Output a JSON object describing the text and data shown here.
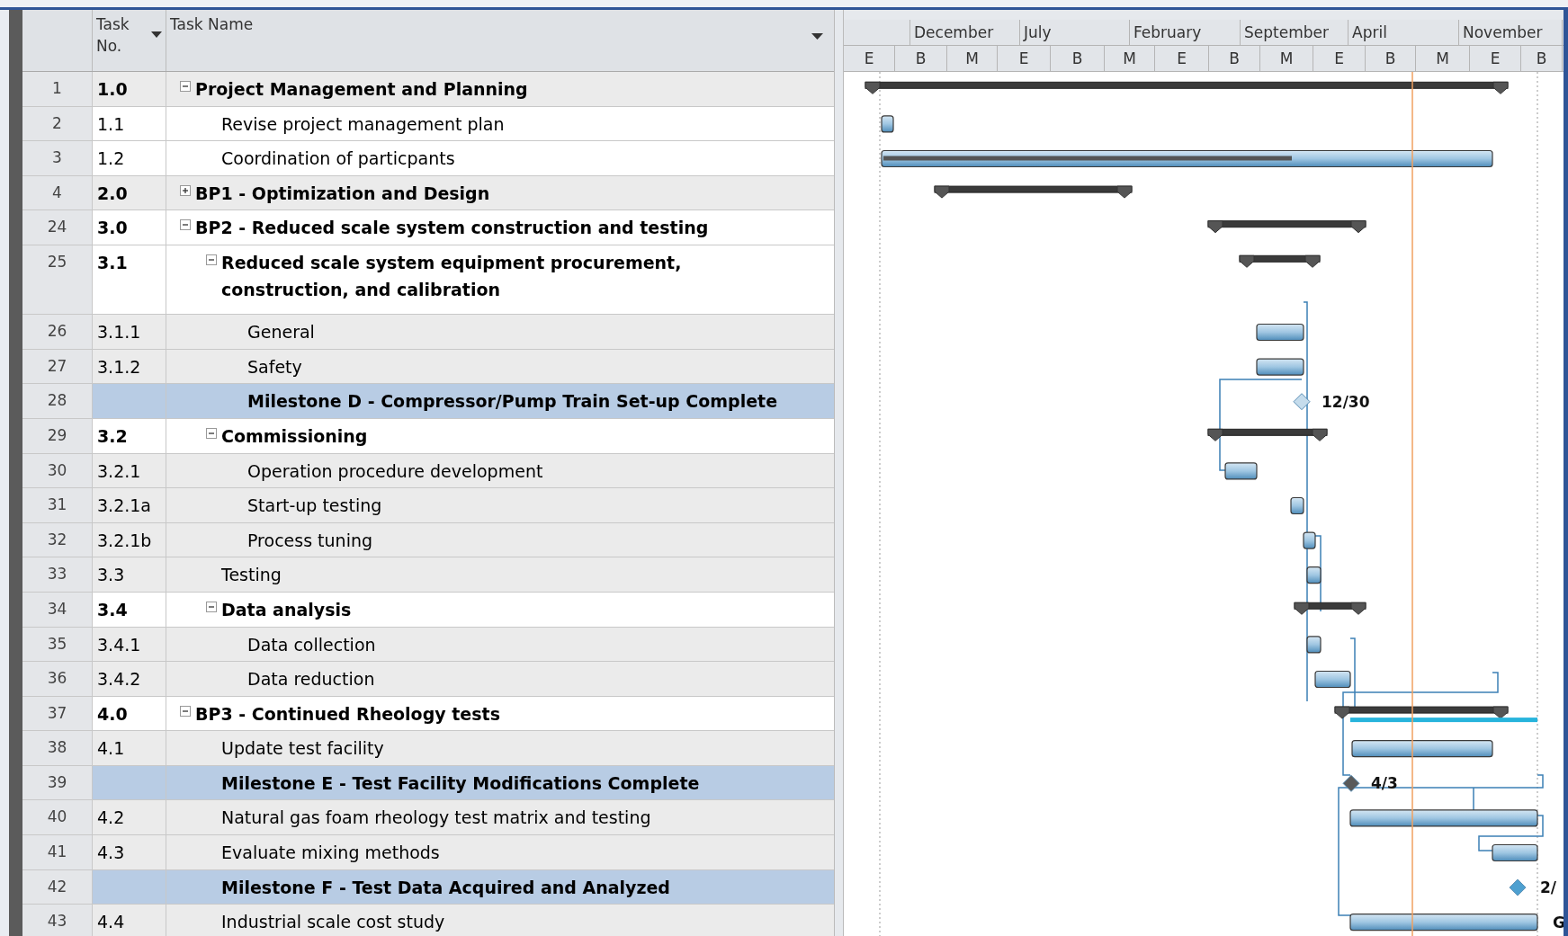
{
  "columns": {
    "task_no": "Task No.",
    "task_name": "Task Name"
  },
  "timeline": {
    "top_tier": [
      "December",
      "July",
      "February",
      "September",
      "April",
      "November"
    ],
    "bottom_tier": [
      "E",
      "B",
      "M",
      "E",
      "B",
      "M",
      "E",
      "B",
      "M",
      "E",
      "B",
      "M",
      "E",
      "B"
    ]
  },
  "tasks": [
    {
      "id": "1",
      "task_no": "1.0",
      "name": "Project Management and Planning",
      "kind": "summary",
      "expanded": true,
      "shaded": true,
      "highlighted": false,
      "children": [
        {
          "id": "2",
          "task_no": "1.1",
          "name": "Revise project management plan",
          "kind": "task",
          "shaded": false,
          "highlighted": false
        },
        {
          "id": "3",
          "task_no": "1.2",
          "name": "Coordination of particpants",
          "kind": "task",
          "shaded": false,
          "highlighted": false
        }
      ]
    },
    {
      "id": "4",
      "task_no": "2.0",
      "name": "BP1 - Optimization and Design",
      "kind": "summary",
      "expanded": false,
      "shaded": true,
      "highlighted": false
    },
    {
      "id": "24",
      "task_no": "3.0",
      "name": "BP2 - Reduced scale system construction and testing",
      "kind": "summary",
      "expanded": true,
      "shaded": false,
      "highlighted": false,
      "children": [
        {
          "id": "25",
          "task_no": "3.1",
          "name": "Reduced scale system equipment procurement, construction, and calibration",
          "kind": "summary",
          "expanded": true,
          "shaded": false,
          "highlighted": false,
          "children": [
            {
              "id": "26",
              "task_no": "3.1.1",
              "name": "General",
              "kind": "task",
              "shaded": true,
              "highlighted": false
            },
            {
              "id": "27",
              "task_no": "3.1.2",
              "name": "Safety",
              "kind": "task",
              "shaded": true,
              "highlighted": false
            },
            {
              "id": "28",
              "name": "Milestone D - Compressor/Pump Train Set-up Complete",
              "kind": "milestone",
              "highlighted": true,
              "bar_label": "12/30"
            }
          ]
        },
        {
          "id": "29",
          "task_no": "3.2",
          "name": "Commissioning",
          "kind": "summary",
          "expanded": true,
          "shaded": false,
          "highlighted": false,
          "children": [
            {
              "id": "30",
              "task_no": "3.2.1",
              "name": "Operation procedure development",
              "kind": "task",
              "shaded": true,
              "highlighted": false
            },
            {
              "id": "31",
              "task_no": "3.2.1a",
              "name": "Start-up testing",
              "kind": "task",
              "shaded": true,
              "highlighted": false
            },
            {
              "id": "32",
              "task_no": "3.2.1b",
              "name": "Process tuning",
              "kind": "task",
              "shaded": true,
              "highlighted": false
            }
          ]
        },
        {
          "id": "33",
          "task_no": "3.3",
          "name": "Testing",
          "kind": "task",
          "shaded": true,
          "highlighted": false
        },
        {
          "id": "34",
          "task_no": "3.4",
          "name": "Data analysis",
          "kind": "summary",
          "expanded": true,
          "shaded": false,
          "highlighted": false,
          "children": [
            {
              "id": "35",
              "task_no": "3.4.1",
              "name": "Data collection",
              "kind": "task",
              "shaded": true,
              "highlighted": false
            },
            {
              "id": "36",
              "task_no": "3.4.2",
              "name": "Data reduction",
              "kind": "task",
              "shaded": true,
              "highlighted": false
            }
          ]
        }
      ]
    },
    {
      "id": "37",
      "task_no": "4.0",
      "name": "BP3 - Continued Rheology tests",
      "kind": "summary",
      "expanded": true,
      "shaded": false,
      "highlighted": false,
      "children": [
        {
          "id": "38",
          "task_no": "4.1",
          "name": "Update test facility",
          "kind": "task",
          "shaded": true,
          "highlighted": false
        },
        {
          "id": "39",
          "name": "Milestone E - Test Facility Modifications Complete",
          "kind": "milestone",
          "highlighted": true,
          "bar_label": "4/3"
        },
        {
          "id": "40",
          "task_no": "4.2",
          "name": "Natural gas foam rheology test matrix and testing",
          "kind": "task",
          "shaded": true,
          "highlighted": false
        },
        {
          "id": "41",
          "task_no": "4.3",
          "name": "Evaluate mixing methods",
          "kind": "task",
          "shaded": true,
          "highlighted": false
        },
        {
          "id": "42",
          "name": "Milestone F - Test Data Acquired and Analyzed",
          "kind": "milestone",
          "highlighted": true,
          "bar_label": "2/"
        },
        {
          "id": "43",
          "task_no": "4.4",
          "name": "Industrial scale cost study",
          "kind": "task",
          "shaded": true,
          "highlighted": false,
          "bar_label": "G"
        }
      ]
    }
  ]
}
